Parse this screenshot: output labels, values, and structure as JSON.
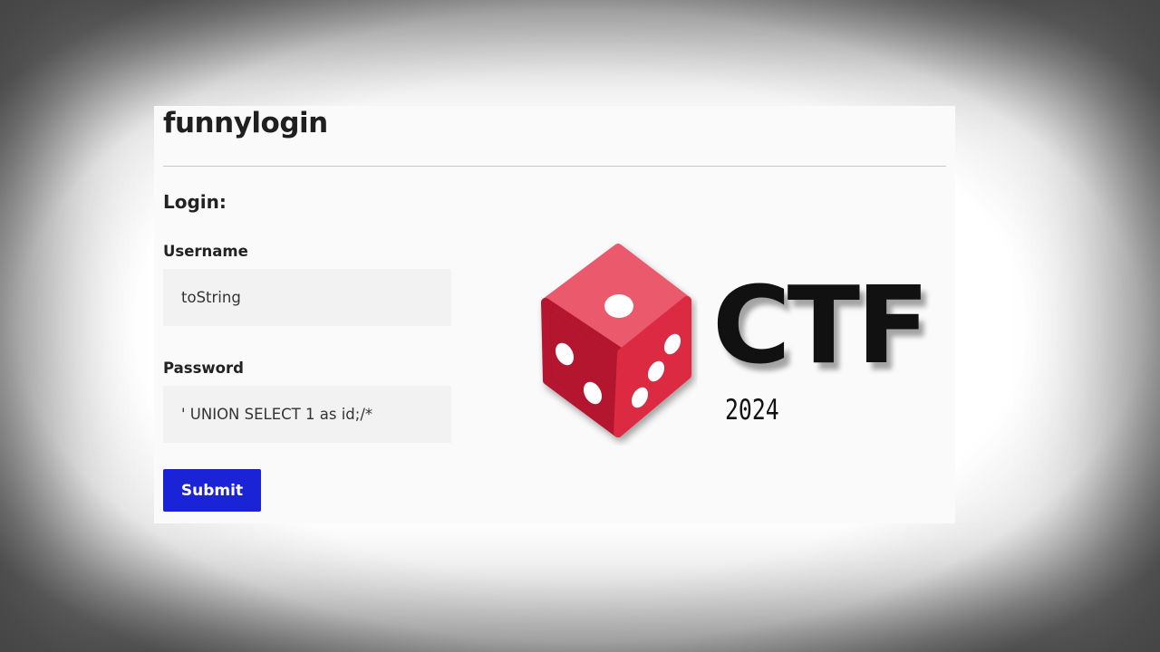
{
  "app": {
    "title": "funnylogin"
  },
  "login_form": {
    "heading": "Login:",
    "username_label": "Username",
    "username_value": "toString",
    "password_label": "Password",
    "password_value": "' UNION SELECT 1 as id;/*",
    "submit_label": "Submit"
  },
  "overlay_logo": {
    "icon": "dice-icon",
    "text": "CTF",
    "year": "2024"
  },
  "colors": {
    "submit_button": "#1a23d6",
    "dice_top": "#ea5a6c",
    "dice_left": "#b3122e",
    "dice_right": "#db2b43"
  }
}
